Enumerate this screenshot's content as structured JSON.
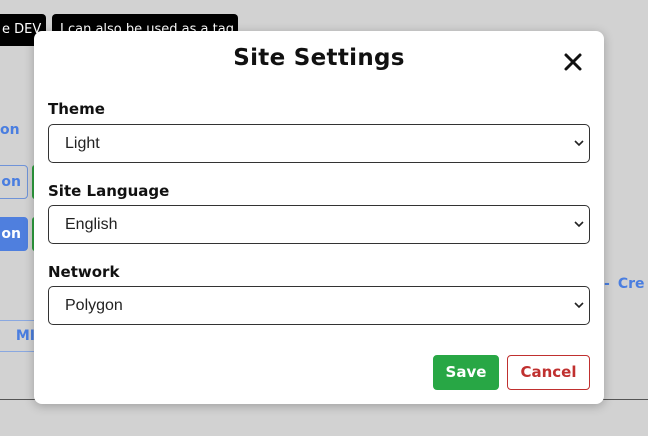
{
  "background": {
    "tags": [
      "e DEV",
      "I can also be used as a tag"
    ],
    "link_text": "on",
    "outline_button_label": "on",
    "solid_button_label": "on",
    "mi_label": "MI",
    "create_link": {
      "dash": "-",
      "text": "Cre"
    }
  },
  "modal": {
    "title": "Site Settings",
    "close_icon": "close-icon",
    "fields": {
      "theme": {
        "label": "Theme",
        "value": "Light"
      },
      "language": {
        "label": "Site Language",
        "value": "English"
      },
      "network": {
        "label": "Network",
        "value": "Polygon"
      }
    },
    "save_label": "Save",
    "cancel_label": "Cancel"
  },
  "colors": {
    "overlay": "#d2d2d2",
    "save": "#28a745",
    "cancel": "#c0302f",
    "link": "#4a7ee0"
  }
}
